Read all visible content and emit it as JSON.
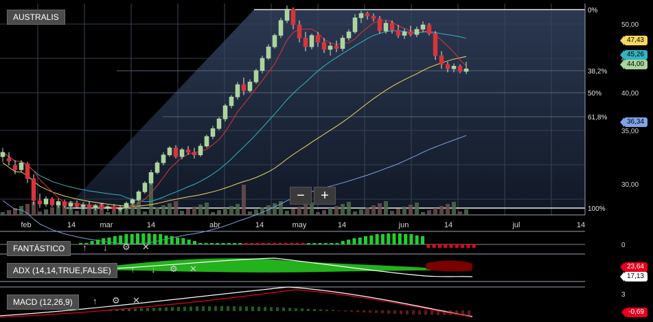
{
  "chart_data": [
    {
      "type": "candlestick",
      "title": "AUSTRALIS",
      "x_tick_labels": [
        "feb",
        "14",
        "mar",
        "14",
        "abr",
        "14",
        "may",
        "14",
        "jun",
        "14",
        "jul",
        "14"
      ],
      "y_axis_labels": [
        "50,00",
        "45,00",
        "40,00",
        "35,00",
        "30,00"
      ],
      "fibonacci_levels": [
        "0%",
        "38,2%",
        "50%",
        "61,8%",
        "100%"
      ],
      "price_tags": [
        {
          "value": "47,43",
          "color": "#f6d860"
        },
        {
          "value": "45,26",
          "color": "#2fb5c5"
        },
        {
          "value": "44,00",
          "color": "#a9d49a"
        },
        {
          "value": "36,34",
          "color": "#7fa3e8"
        }
      ],
      "ohlc": [
        [
          34.0,
          35.0,
          33.4,
          34.5
        ],
        [
          33.8,
          34.5,
          33.0,
          33.5
        ],
        [
          33.0,
          33.6,
          32.0,
          32.5
        ],
        [
          32.5,
          33.6,
          32.2,
          33.3
        ],
        [
          33.2,
          33.4,
          31.0,
          31.5
        ],
        [
          31.5,
          32.0,
          28.5,
          29.0
        ],
        [
          29.0,
          29.8,
          28.2,
          28.6
        ],
        [
          28.6,
          29.5,
          28.3,
          29.2
        ],
        [
          29.2,
          29.4,
          28.3,
          28.5
        ],
        [
          28.5,
          29.2,
          28.2,
          28.9
        ],
        [
          28.9,
          29.1,
          28.2,
          28.4
        ],
        [
          28.4,
          29.0,
          28.0,
          28.7
        ],
        [
          28.7,
          29.0,
          28.1,
          28.3
        ],
        [
          28.3,
          28.8,
          28.0,
          28.5
        ],
        [
          28.5,
          28.9,
          28.1,
          28.2
        ],
        [
          28.2,
          28.6,
          27.9,
          28.4
        ],
        [
          28.4,
          28.7,
          28.0,
          28.1
        ],
        [
          28.1,
          28.5,
          27.8,
          28.3
        ],
        [
          28.3,
          28.6,
          27.9,
          28.0
        ],
        [
          28.0,
          28.5,
          27.7,
          28.2
        ],
        [
          28.2,
          28.9,
          28.0,
          28.7
        ],
        [
          28.7,
          29.3,
          28.5,
          29.1
        ],
        [
          29.1,
          30.2,
          28.9,
          30.0
        ],
        [
          30.0,
          31.2,
          29.8,
          31.0
        ],
        [
          31.0,
          32.5,
          30.8,
          32.2
        ],
        [
          32.2,
          33.5,
          32.0,
          33.3
        ],
        [
          33.3,
          34.5,
          33.0,
          34.2
        ],
        [
          34.2,
          35.2,
          34.0,
          35.0
        ],
        [
          35.0,
          35.3,
          33.8,
          34.0
        ],
        [
          34.0,
          35.0,
          33.7,
          34.8
        ],
        [
          34.8,
          35.2,
          34.2,
          34.5
        ],
        [
          34.5,
          35.0,
          33.8,
          34.2
        ],
        [
          34.2,
          35.5,
          34.0,
          35.2
        ],
        [
          35.2,
          36.5,
          35.0,
          36.3
        ],
        [
          36.3,
          37.5,
          36.0,
          37.2
        ],
        [
          37.2,
          38.5,
          37.0,
          38.3
        ],
        [
          38.3,
          40.0,
          38.0,
          39.8
        ],
        [
          39.8,
          41.0,
          39.5,
          40.8
        ],
        [
          40.8,
          42.5,
          40.5,
          42.2
        ],
        [
          42.2,
          43.0,
          41.0,
          41.5
        ],
        [
          41.5,
          42.8,
          41.3,
          42.5
        ],
        [
          42.5,
          44.0,
          42.3,
          43.8
        ],
        [
          43.8,
          45.5,
          43.5,
          45.2
        ],
        [
          45.2,
          46.8,
          45.0,
          46.5
        ],
        [
          46.5,
          48.0,
          46.3,
          47.8
        ],
        [
          47.8,
          49.8,
          47.5,
          49.5
        ],
        [
          49.5,
          51.2,
          49.2,
          50.8
        ],
        [
          50.8,
          51.0,
          48.5,
          49.0
        ],
        [
          49.0,
          49.5,
          47.0,
          47.5
        ],
        [
          47.5,
          48.2,
          46.0,
          46.5
        ],
        [
          46.5,
          48.0,
          46.2,
          47.8
        ],
        [
          47.8,
          48.2,
          46.5,
          47.0
        ],
        [
          47.0,
          47.5,
          45.8,
          46.2
        ],
        [
          46.2,
          47.0,
          45.5,
          46.6
        ],
        [
          46.6,
          47.2,
          45.9,
          46.3
        ],
        [
          46.3,
          47.8,
          46.0,
          47.5
        ],
        [
          47.5,
          48.5,
          47.2,
          48.2
        ],
        [
          48.2,
          50.2,
          48.0,
          49.8
        ],
        [
          49.8,
          50.6,
          49.2,
          50.3
        ],
        [
          50.3,
          50.5,
          49.6,
          50.0
        ],
        [
          50.0,
          50.3,
          49.4,
          49.7
        ],
        [
          49.7,
          50.0,
          48.0,
          48.3
        ],
        [
          48.3,
          49.5,
          48.0,
          49.2
        ],
        [
          49.2,
          49.5,
          48.0,
          48.4
        ],
        [
          48.4,
          49.0,
          47.5,
          47.8
        ],
        [
          47.8,
          48.6,
          47.4,
          48.2
        ],
        [
          48.2,
          48.9,
          47.7,
          47.9
        ],
        [
          47.9,
          48.8,
          47.6,
          48.5
        ],
        [
          48.5,
          49.4,
          48.2,
          49.0
        ],
        [
          49.0,
          49.2,
          47.8,
          48.0
        ],
        [
          48.0,
          48.3,
          45.0,
          45.5
        ],
        [
          45.5,
          46.0,
          44.0,
          44.5
        ],
        [
          44.5,
          44.8,
          43.6,
          44.0
        ],
        [
          44.0,
          44.6,
          43.6,
          44.3
        ],
        [
          44.3,
          44.5,
          43.5,
          43.7
        ],
        [
          43.7,
          44.8,
          43.4,
          44.0
        ]
      ]
    },
    {
      "type": "bar",
      "title": "FANTÁSTICO",
      "y_axis_labels": [
        "0"
      ]
    },
    {
      "type": "line",
      "title": "ADX (14,14,TRUE,FALSE)",
      "tags": [
        {
          "value": "23,64",
          "color": "#e8001c"
        },
        {
          "value": "17,13",
          "color": "#ffffff"
        }
      ]
    },
    {
      "type": "line",
      "title": "MACD (12,26,9)",
      "y_axis_labels": [
        "3"
      ],
      "tags": [
        {
          "value": "-0,69",
          "color": "#e8001c"
        }
      ]
    }
  ],
  "zoom": {
    "minus": "−",
    "plus": "+"
  },
  "tool_icons": [
    "chevron-up-icon",
    "chevron-down-icon",
    "gear-icon",
    "close-icon"
  ]
}
